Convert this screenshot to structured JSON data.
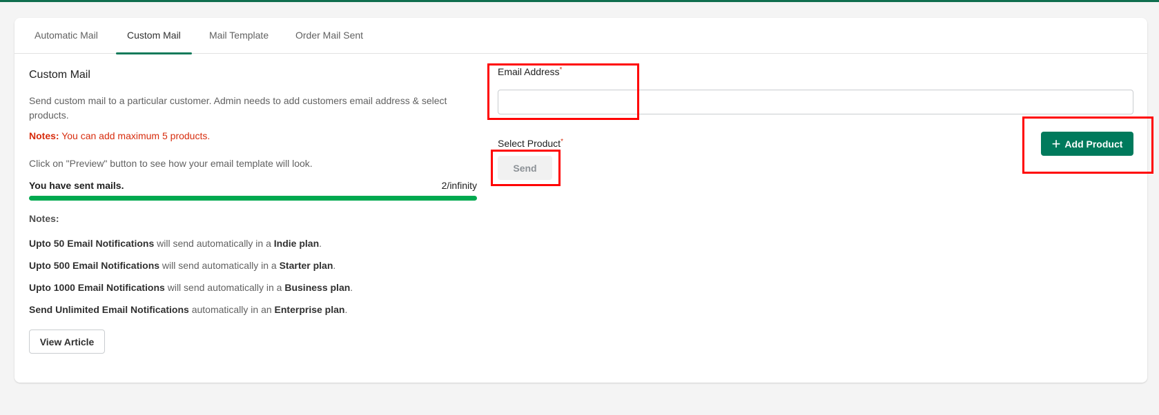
{
  "tabs": [
    "Automatic Mail",
    "Custom Mail",
    "Mail Template",
    "Order Mail Sent"
  ],
  "left": {
    "title": "Custom Mail",
    "description": "Send custom mail to a particular customer. Admin needs to add customers email address & select products.",
    "notes_label": "Notes:",
    "notes_text": " You can add maximum 5 products.",
    "preview_hint": "Click on \"Preview\" button to see how your email template will look.",
    "sent_label": "You have sent mails.",
    "sent_count": "2/infinity",
    "progress_percent": 100,
    "notes_heading": "Notes:",
    "plans": [
      {
        "a": "Upto 50 Email Notifications",
        "b": " will send automatically in a ",
        "c": "Indie plan",
        "d": "."
      },
      {
        "a": "Upto 500 Email Notifications",
        "b": " will send automatically in a ",
        "c": "Starter plan",
        "d": "."
      },
      {
        "a": "Upto 1000 Email Notifications",
        "b": " will send automatically in a ",
        "c": "Business plan",
        "d": "."
      },
      {
        "a": "Send Unlimited Email Notifications",
        "b": " automatically in an ",
        "c": "Enterprise plan",
        "d": "."
      }
    ],
    "view_article": "View Article"
  },
  "right": {
    "email_label": "Email Address",
    "required": "*",
    "email_value": "",
    "product_label": "Select Product",
    "add_product": "Add Product",
    "send": "Send"
  },
  "colors": {
    "accent": "#007a5c",
    "progress": "#00a94f",
    "highlight": "#ff0000"
  }
}
